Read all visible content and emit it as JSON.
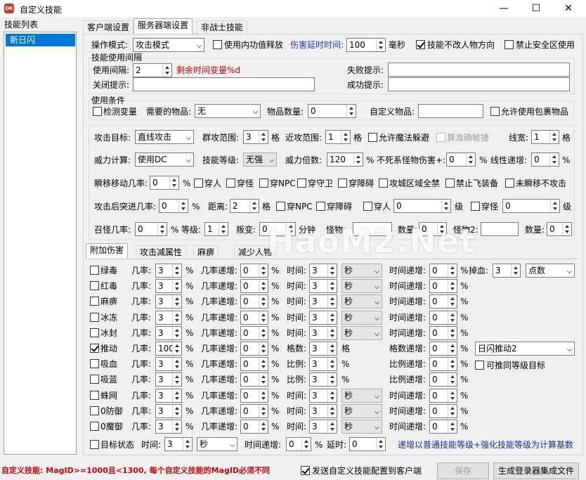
{
  "window": {
    "title": "自定义技能",
    "minimize": "—",
    "maximize": "☐",
    "close": "✕"
  },
  "left": {
    "label": "技能列表",
    "items": [
      "新日闪"
    ]
  },
  "tabs": [
    "客户端设置",
    "服务器端设置",
    "非战士技能"
  ],
  "top": {
    "attack_mode_label": "操作模式:",
    "attack_mode_value": "攻击模式",
    "use_inner_label": "使用内功值释放",
    "delay_label": "伤害延时时间:",
    "delay_value": "100",
    "delay_unit": "毫秒",
    "no_turn_label": "技能不改人物方向",
    "no_safe_label": "禁止安全区使用",
    "interval_group": "技能使用间隔",
    "interval_label": "使用间隔:",
    "interval_value": "2",
    "remain_hint": "剩余时间变量%d",
    "fail_label": "失败提示:",
    "close_label": "关闭提示:",
    "success_label": "成功提示:",
    "cond_group": "使用条件",
    "check_var_label": "检测变量",
    "need_item_label": "需要的物品:",
    "need_item_value": "无",
    "item_count_label": "物品数量:",
    "item_count_value": "0",
    "custom_item_label": "自定义物品:",
    "allow_bag_label": "允许使用包裹物品"
  },
  "mid": {
    "target_label": "攻击目标:",
    "target_value": "直线攻击",
    "group_range_label": "群攻范围:",
    "group_range_value": "3",
    "grid": "格",
    "near_range_label": "近攻范围:",
    "near_range_value": "1",
    "allow_dodge_label": "允许魔法躲避",
    "acc_dodge_label": "算准确敏捷",
    "line_width_label": "线宽:",
    "line_width_value": "1",
    "power_calc_label": "威力计算:",
    "power_calc_value": "使用DC",
    "skill_level_label": "技能等级:",
    "skill_level_value": "无强",
    "power_mult_label": "威力倍数:",
    "power_mult_value": "120",
    "pct": "%",
    "undead_label": "不死系怪物伤害+:",
    "undead_value": "0",
    "linear_label": "线性递增:",
    "linear_value": "0",
    "tp_label": "瞬移移动几率:",
    "tp_value": "0",
    "tp_opts": [
      "穿人",
      "穿怪",
      "穿NPC",
      "穿守卫",
      "穿障碍",
      "攻城区域全禁",
      "禁止飞装备",
      "未瞬移不攻击"
    ],
    "after_label": "攻击后突进几率:",
    "after_value": "0",
    "dist_label": "距离:",
    "dist_value": "2",
    "after_opts": [
      "穿NPC",
      "穿障碍",
      "穿人",
      "穿怪"
    ],
    "after_lv1": "0",
    "lv": "级",
    "after_lv2": "0",
    "summon_label": "召怪几率:",
    "summon_value": "0",
    "level_label": "等级:",
    "level_value": "1",
    "change_label": "叛变:",
    "change_value": "0",
    "minute": "分钟",
    "monster_label": "怪物:",
    "count_label": "数量:",
    "count_value": "0",
    "monster2_label": "怪物2:",
    "count2_value": "0"
  },
  "subtabs": [
    "附加伤害",
    "攻击减属性",
    "麻痹",
    "减少人物"
  ],
  "watermark": "HaoM2.Net",
  "rows": [
    {
      "name": "绿毒",
      "checked": false,
      "rate": "3",
      "inc": "0",
      "kind": "time",
      "tval": "3",
      "unit": "秒",
      "tinc": "0"
    },
    {
      "name": "红毒",
      "checked": false,
      "rate": "3",
      "inc": "0",
      "kind": "time",
      "tval": "3",
      "unit": "秒",
      "tinc": "0"
    },
    {
      "name": "麻痹",
      "checked": false,
      "rate": "3",
      "inc": "0",
      "kind": "time",
      "tval": "3",
      "unit": "秒",
      "tinc": "0"
    },
    {
      "name": "冰冻",
      "checked": false,
      "rate": "3",
      "inc": "0",
      "kind": "time",
      "tval": "3",
      "unit": "秒",
      "tinc": "0"
    },
    {
      "name": "冰封",
      "checked": false,
      "rate": "3",
      "inc": "0",
      "kind": "time",
      "tval": "3",
      "unit": "秒",
      "tinc": "0"
    },
    {
      "name": "推动",
      "checked": true,
      "rate": "100",
      "inc": "0",
      "kind": "grid",
      "tval": "3",
      "unit": "格",
      "tinc": "0"
    },
    {
      "name": "吸血",
      "checked": false,
      "rate": "3",
      "inc": "0",
      "kind": "ratio",
      "tval": "3",
      "unit": "%",
      "tinc": "0"
    },
    {
      "name": "吸蓝",
      "checked": false,
      "rate": "3",
      "inc": "0",
      "kind": "ratio",
      "tval": "3",
      "unit": "%",
      "tinc": "0"
    },
    {
      "name": "蛛网",
      "checked": false,
      "rate": "3",
      "inc": "0",
      "kind": "time",
      "tval": "3",
      "unit": "秒",
      "tinc": "0"
    },
    {
      "name": "0防御",
      "checked": false,
      "rate": "3",
      "inc": "0",
      "kind": "time",
      "tval": "3",
      "unit": "秒",
      "tinc": "0"
    },
    {
      "name": "0魔御",
      "checked": false,
      "rate": "3",
      "inc": "0",
      "kind": "time",
      "tval": "3",
      "unit": "秒",
      "tinc": "0"
    }
  ],
  "row_labels": {
    "rate": "几率:",
    "inc": "几率递增:",
    "time": "时间:",
    "grid": "格数:",
    "ratio": "比例:",
    "tinc": "时间递增:",
    "ginc": "格数递增:",
    "rinc": "比例递增:",
    "pct": "%"
  },
  "drop_blood": {
    "label": "掉血:",
    "value": "3",
    "unit": "点数"
  },
  "push": {
    "combo": "日闪推动2",
    "chk_label": "可推同等级目标"
  },
  "target_state": {
    "label": "目标状态",
    "time_label": "时间:",
    "time_value": "3",
    "unit": "秒",
    "inc_label": "时间递增:",
    "inc_value": "0",
    "pct": "%",
    "delay_label": "延时:",
    "delay_value": "0"
  },
  "note": "递增以普通技能等级+强化技能等级为计算基数",
  "bottom": {
    "warn": "自定义技能: MagID>=1000且<1300, 每个自定义技能的MagID必须不同",
    "send_label": "发送自定义技能配置到客户端",
    "save": "保存",
    "gen": "生成登录器集成文件"
  }
}
